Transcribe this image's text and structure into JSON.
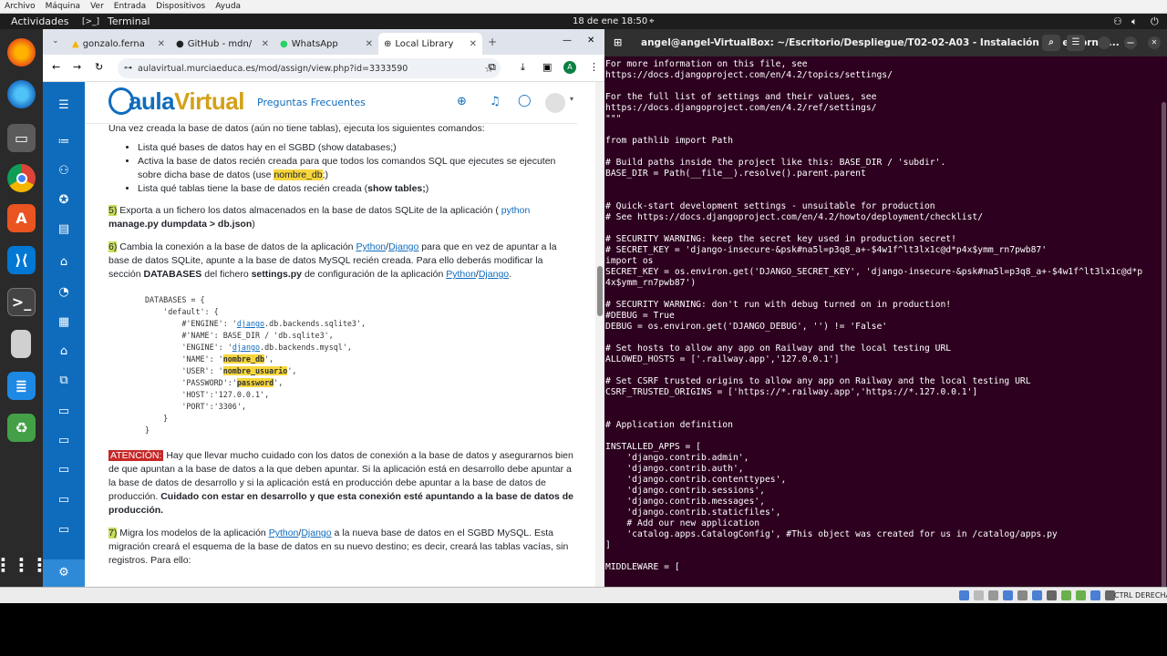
{
  "vm_menu": [
    "Archivo",
    "Máquina",
    "Ver",
    "Entrada",
    "Dispositivos",
    "Ayuda"
  ],
  "gnome": {
    "activities": "Actividades",
    "app": "Terminal",
    "clock": "18 de ene  18:50"
  },
  "browser": {
    "tabs": [
      {
        "label": "gonzalo.ferna",
        "icon": "google-drive-icon"
      },
      {
        "label": "GitHub - mdn/",
        "icon": "github-icon"
      },
      {
        "label": "WhatsApp",
        "icon": "whatsapp-icon"
      },
      {
        "label": "Local Library",
        "icon": "globe-icon"
      }
    ],
    "new_tab": "+",
    "url": "aulavirtual.murciaeduca.es/mod/assign/view.php?id=3333590",
    "profile_letter": "A"
  },
  "site": {
    "logo_a": "aula",
    "logo_b": "Virtual",
    "faq": "Preguntas Frecuentes"
  },
  "content": {
    "intro": "Una vez creada la base de datos (aún no tiene tablas), ejecuta los siguientes comandos:",
    "bullet1": "Lista qué bases de datos hay en el SGBD (show databases;)",
    "bullet2a": "Activa la base de datos recién creada para que todos los comandos SQL que ejecutes se ejecuten sobre dicha base de datos (use ",
    "bullet2_hl": "nombre_db",
    "bullet2b": ";)",
    "bullet3a": "Lista qué tablas tiene la base de datos recién creada (",
    "bullet3b": "show tables;",
    "bullet3c": ")",
    "step5_num": "5)",
    "step5_a": " Exporta a un fichero los datos almacenados en la base de datos SQLite de la aplicación ( ",
    "step5_cmd_a": "python",
    "step5_cmd_b": "manage.py dumpdata > db.json",
    "step5_b": ")",
    "step6_num": "6)",
    "step6_a": " Cambia la conexión a la base de datos de la aplicación ",
    "python": "Python",
    "django": "Django",
    "step6_b": " para que en vez de apuntar a la base de datos SQLite, apunte a la base de datos MySQL recién creada. Para ello deberás modificar la sección ",
    "databases": "DATABASES",
    "step6_c": " del fichero ",
    "settings": "settings.py",
    "step6_d": " de configuración de la aplicación ",
    "step6_e": ".",
    "code": {
      "l1": "DATABASES = {",
      "l2": "    'default': {",
      "l3a": "        #'ENGINE': '",
      "l3b": "django",
      "l3c": ".db.backends.sqlite3',",
      "l4": "        #'NAME': BASE_DIR / 'db.sqlite3',",
      "l5a": "        'ENGINE': '",
      "l5b": "django",
      "l5c": ".db.backends.mysql',",
      "l6a": "        'NAME': '",
      "l6b": "nombre_db",
      "l6c": "',",
      "l7a": "        'USER': '",
      "l7b": "nombre_usuario",
      "l7c": "',",
      "l8a": "        'PASSWORD':'",
      "l8b": "password",
      "l8c": "',",
      "l9": "        'HOST':'127.0.0.1',",
      "l10": "        'PORT':'3306',",
      "l11": "    }",
      "l12": "}"
    },
    "attention": "ATENCIÓN:",
    "att_a": " Hay que llevar mucho cuidado con los datos de conexión a la base de datos y asegurarnos bien de que apuntan a la base de datos a la que deben apuntar. Si la aplicación está en desarrollo debe apuntar a la base de datos de desarrollo y si la aplicación está en producción debe apuntar a la base de datos de producción. ",
    "att_b": "Cuidado con estar en desarrollo y que esta conexión esté apuntando a la base de datos de producción.",
    "step7_num": "7)",
    "step7_a": " Migra los modelos de la aplicación ",
    "step7_b": " a la nueva base de datos en el SGBD MySQL. Esta migración creará el esquema de la base de datos en su nuevo destino; es decir, creará las tablas vacías, sin registros. Para ello:"
  },
  "terminal": {
    "title": "angel@angel-VirtualBox: ~/Escritorio/Despliegue/T02-02-A03 - Instalación del entorno ...",
    "lines": [
      "For more information on this file, see",
      "https://docs.djangoproject.com/en/4.2/topics/settings/",
      "",
      "For the full list of settings and their values, see",
      "https://docs.djangoproject.com/en/4.2/ref/settings/",
      "\"\"\"",
      "",
      "from pathlib import Path",
      "",
      "# Build paths inside the project like this: BASE_DIR / 'subdir'.",
      "BASE_DIR = Path(__file__).resolve().parent.parent",
      "",
      "",
      "# Quick-start development settings - unsuitable for production",
      "# See https://docs.djangoproject.com/en/4.2/howto/deployment/checklist/",
      "",
      "# SECURITY WARNING: keep the secret key used in production secret!",
      "# SECRET_KEY = 'django-insecure-&psk#na5l=p3q8_a+-$4w1f^lt3lx1c@d*p4x$ymm_rn7pwb87'",
      "import os",
      "SECRET_KEY = os.environ.get('DJANGO_SECRET_KEY', 'django-insecure-&psk#na5l=p3q8_a+-$4w1f^lt3lx1c@d*p",
      "4x$ymm_rn7pwb87')",
      "",
      "# SECURITY WARNING: don't run with debug turned on in production!",
      "#DEBUG = True",
      "DEBUG = os.environ.get('DJANGO_DEBUG', '') != 'False'",
      "",
      "# Set hosts to allow any app on Railway and the local testing URL",
      "ALLOWED_HOSTS = ['.railway.app','127.0.0.1']",
      "",
      "# Set CSRF trusted origins to allow any app on Railway and the local testing URL",
      "CSRF_TRUSTED_ORIGINS = ['https://*.railway.app','https://*.127.0.0.1']",
      "",
      "",
      "# Application definition",
      "",
      "INSTALLED_APPS = [",
      "    'django.contrib.admin',",
      "    'django.contrib.auth',",
      "    'django.contrib.contenttypes',",
      "    'django.contrib.sessions',",
      "    'django.contrib.messages',",
      "    'django.contrib.staticfiles',",
      "    # Add our new application",
      "    'catalog.apps.CatalogConfig', #This object was created for us in /catalog/apps.py",
      "]",
      "",
      "MIDDLEWARE = ["
    ]
  },
  "vm_status": {
    "host_key": "CTRL DERECHA"
  },
  "colors": {
    "moodle_blue": "#0f6cbd",
    "terminal_bg": "#2c001e",
    "highlight": "#f7d63c",
    "step_green": "#c7e05b",
    "attention_red": "#c62828"
  }
}
